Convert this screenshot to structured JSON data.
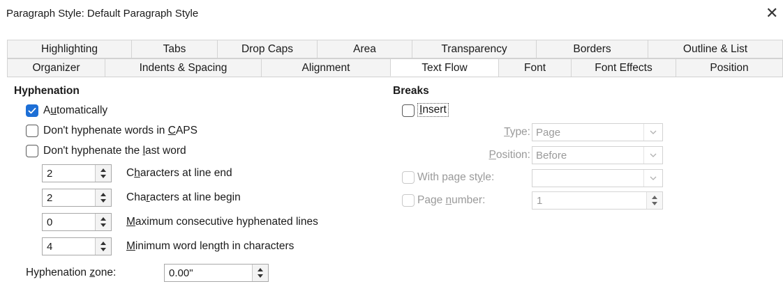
{
  "window": {
    "title": "Paragraph Style: Default Paragraph Style",
    "close_glyph": "✕"
  },
  "tabs_row1": [
    "Highlighting",
    "Tabs",
    "Drop Caps",
    "Area",
    "Transparency",
    "Borders",
    "Outline & List"
  ],
  "tabs_row2": [
    "Organizer",
    "Indents & Spacing",
    "Alignment",
    "Text Flow",
    "Font",
    "Font Effects",
    "Position"
  ],
  "active_tab": "Text Flow",
  "hyphenation": {
    "heading": "Hyphenation",
    "automatically": {
      "pre": "A",
      "key": "u",
      "post": "tomatically",
      "checked": true
    },
    "dont_caps": {
      "pre": "Don't hyphenate words in ",
      "key": "C",
      "post": "APS",
      "checked": false
    },
    "dont_last": {
      "pre": "Don't hyphenate the ",
      "key": "l",
      "post": "ast word",
      "checked": false
    },
    "chars_end": {
      "value": "2",
      "pre": "C",
      "key": "h",
      "post": "aracters at line end"
    },
    "chars_begin": {
      "value": "2",
      "pre": "Cha",
      "key": "r",
      "post": "acters at line begin"
    },
    "max_lines": {
      "value": "0",
      "pre": "",
      "key": "M",
      "post": "aximum consecutive hyphenated lines"
    },
    "min_word": {
      "value": "4",
      "pre": "",
      "key": "M",
      "post": "inimum word length in characters"
    },
    "zone": {
      "pre": "Hyphenation ",
      "key": "z",
      "post": "one:",
      "value": "0.00\""
    }
  },
  "breaks": {
    "heading": "Breaks",
    "insert": {
      "pre": "",
      "key": "I",
      "post": "nsert",
      "checked": false
    },
    "type": {
      "pre": "",
      "key": "T",
      "post": "ype:",
      "value": "Page"
    },
    "position": {
      "pre": "",
      "key": "P",
      "post": "osition:",
      "value": "Before"
    },
    "page_style": {
      "pre": "With page st",
      "key": "y",
      "post": "le:",
      "value": ""
    },
    "page_number": {
      "pre": "Page ",
      "key": "n",
      "post": "umber:",
      "value": "1"
    }
  },
  "colors": {
    "accent": "#1d6fd6",
    "disabled_text": "#9a9a9a"
  },
  "icons": {
    "close": "close-icon",
    "check": "checkmark-icon",
    "spin_up": "spin-up-icon",
    "spin_down": "spin-down-icon",
    "dropdown": "chevron-down-icon"
  }
}
